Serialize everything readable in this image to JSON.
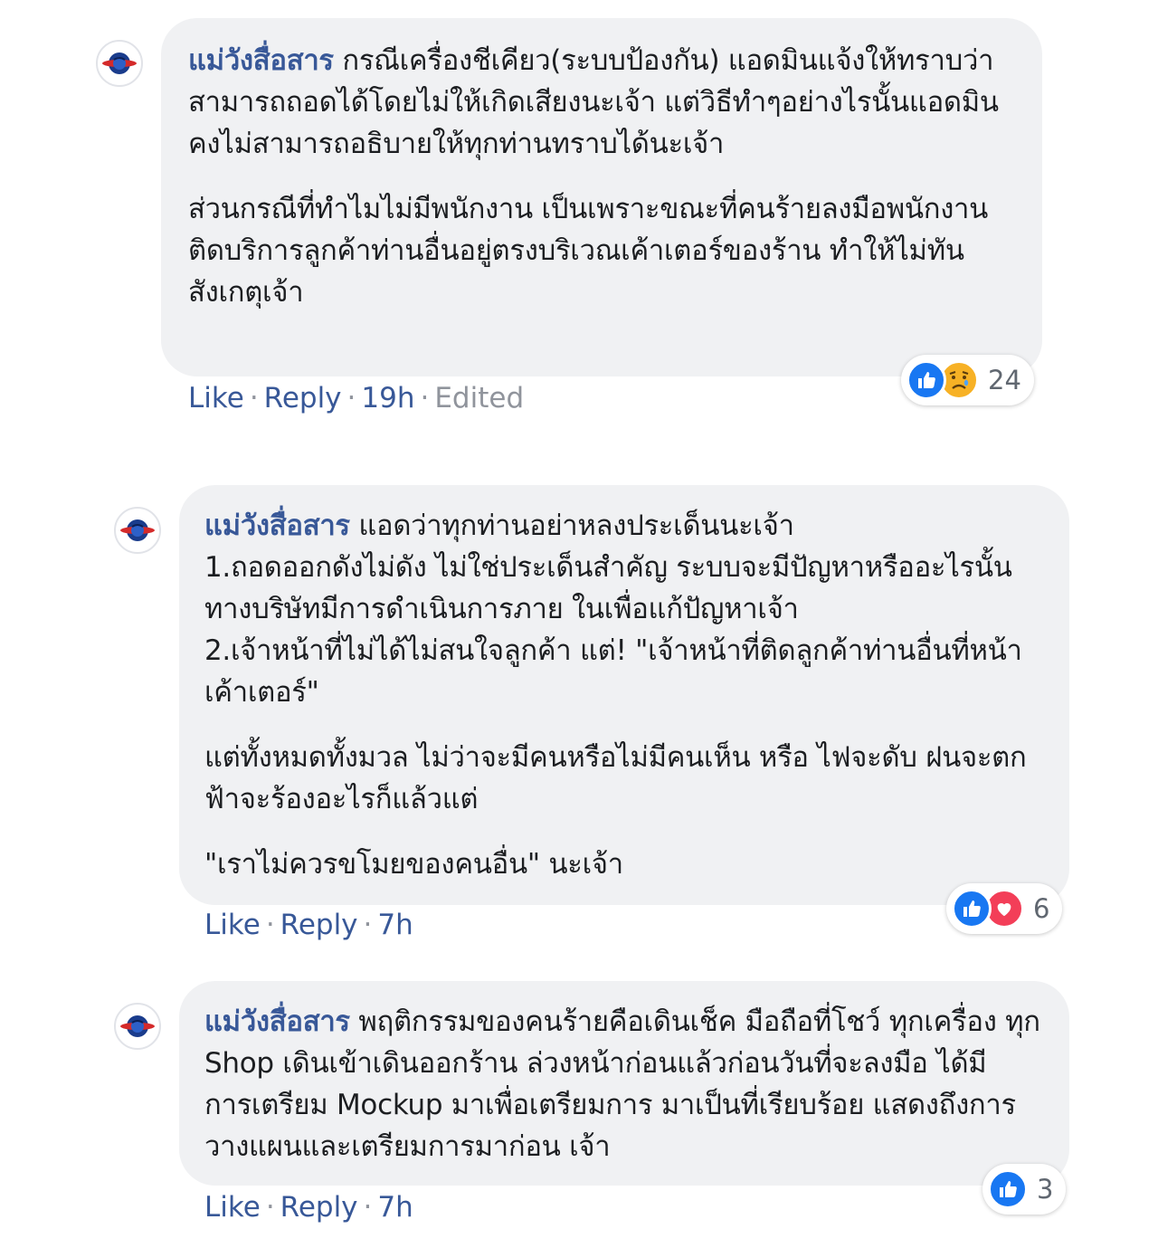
{
  "comments": [
    {
      "author": "แม่วังสื่อสาร",
      "paragraphs": [
        "กรณีเครื่องชีเคียว(ระบบป้องกัน) แอดมินแจ้งให้ทราบว่า สามารถถอดได้โดยไม่ให้เกิดเสียงนะเจ้า แต่วิธีทำๆอย่างไรนั้นแอดมินคงไม่สามารถอธิบายให้ทุกท่านทราบได้นะเจ้า",
        "ส่วนกรณีที่ทำไมไม่มีพนักงาน เป็นเพราะขณะที่คนร้ายลงมือพนักงานติดบริการลูกค้าท่านอื่นอยู่ตรงบริเวณเค้าเตอร์ของร้าน ทำให้ไม่ทันสังเกตุเจ้า"
      ],
      "actions": {
        "like": "Like",
        "reply": "Reply",
        "time": "19h",
        "edited": "Edited"
      },
      "reactions": {
        "icons": [
          "like-icon",
          "sad-icon"
        ],
        "count": "24"
      }
    },
    {
      "author": "แม่วังสื่อสาร",
      "paragraphs": [
        "แอดว่าทุกท่านอย่าหลงประเด็นนะเจ้า\n1.ถอดออกดังไม่ดัง ไม่ใช่ประเด็นสำคัญ ระบบจะมีปัญหาหรืออะไรนั้นทางบริษัทมีการดำเนินการภาย ในเพื่อแก้ปัญหาเจ้า\n2.เจ้าหน้าที่ไม่ได้ไม่สนใจลูกค้า แต่! \"เจ้าหน้าที่ติดลูกค้าท่านอื่นที่หน้าเค้าเตอร์\"",
        "แต่ทั้งหมดทั้งมวล ไม่ว่าจะมีคนหรือไม่มีคนเห็น หรือ ไฟจะดับ ฝนจะตกฟ้าจะร้องอะไรก็แล้วแต่",
        "\"เราไม่ควรขโมยของคนอื่น\" นะเจ้า"
      ],
      "actions": {
        "like": "Like",
        "reply": "Reply",
        "time": "7h"
      },
      "reactions": {
        "icons": [
          "like-icon",
          "love-icon"
        ],
        "count": "6"
      }
    },
    {
      "author": "แม่วังสื่อสาร",
      "paragraphs": [
        "พฤติกรรมของคนร้ายคือเดินเช็ค มือถือที่โชว์ ทุกเครื่อง ทุก Shop เดินเข้าเดินออกร้าน ล่วงหน้าก่อนแล้วก่อนวันที่จะลงมือ ได้มีการเตรียม Mockup มาเพื่อเตรียมการ มาเป็นที่เรียบร้อย แสดงถึงการวางแผนและเตรียมการมาก่อน เจ้า"
      ],
      "actions": {
        "like": "Like",
        "reply": "Reply",
        "time": "7h"
      },
      "reactions": {
        "icons": [
          "like-icon"
        ],
        "count": "3"
      }
    }
  ],
  "colors": {
    "author": "#385898",
    "bubble": "#f0f1f3",
    "meta": "#90949c",
    "like": "#1877f2",
    "love": "#f33e58",
    "sad": "#f7b125"
  }
}
